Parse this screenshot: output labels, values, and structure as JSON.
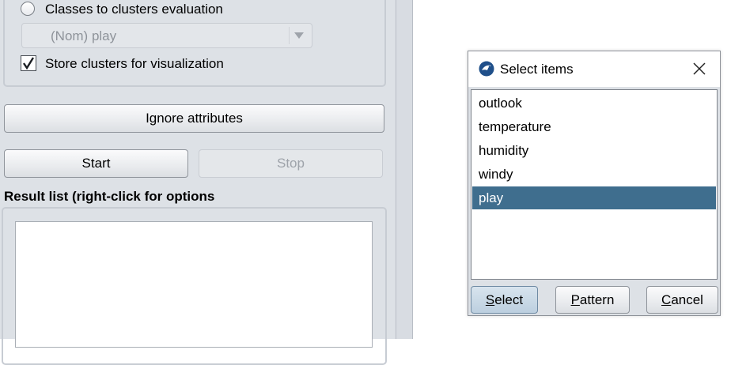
{
  "left_panel": {
    "classes_to_clusters": "Classes to clusters evaluation",
    "class_combo_value": "(Nom) play",
    "store_clusters": "Store clusters for visualization",
    "store_clusters_checked": true,
    "ignore_attributes": "Ignore attributes",
    "start": "Start",
    "stop": "Stop",
    "result_list_label": "Result list (right-click for options"
  },
  "dialog": {
    "title": "Select items",
    "items": [
      {
        "label": "outlook",
        "selected": false
      },
      {
        "label": "temperature",
        "selected": false
      },
      {
        "label": "humidity",
        "selected": false
      },
      {
        "label": "windy",
        "selected": false
      },
      {
        "label": "play",
        "selected": true
      }
    ],
    "buttons": {
      "select": {
        "mnemonic": "S",
        "rest": "elect"
      },
      "pattern": {
        "mnemonic": "P",
        "rest": "attern"
      },
      "cancel": {
        "mnemonic": "C",
        "rest": "ancel"
      }
    }
  },
  "colors": {
    "selection": "#3f6e8e",
    "panel_bg": "#dde1e6"
  }
}
